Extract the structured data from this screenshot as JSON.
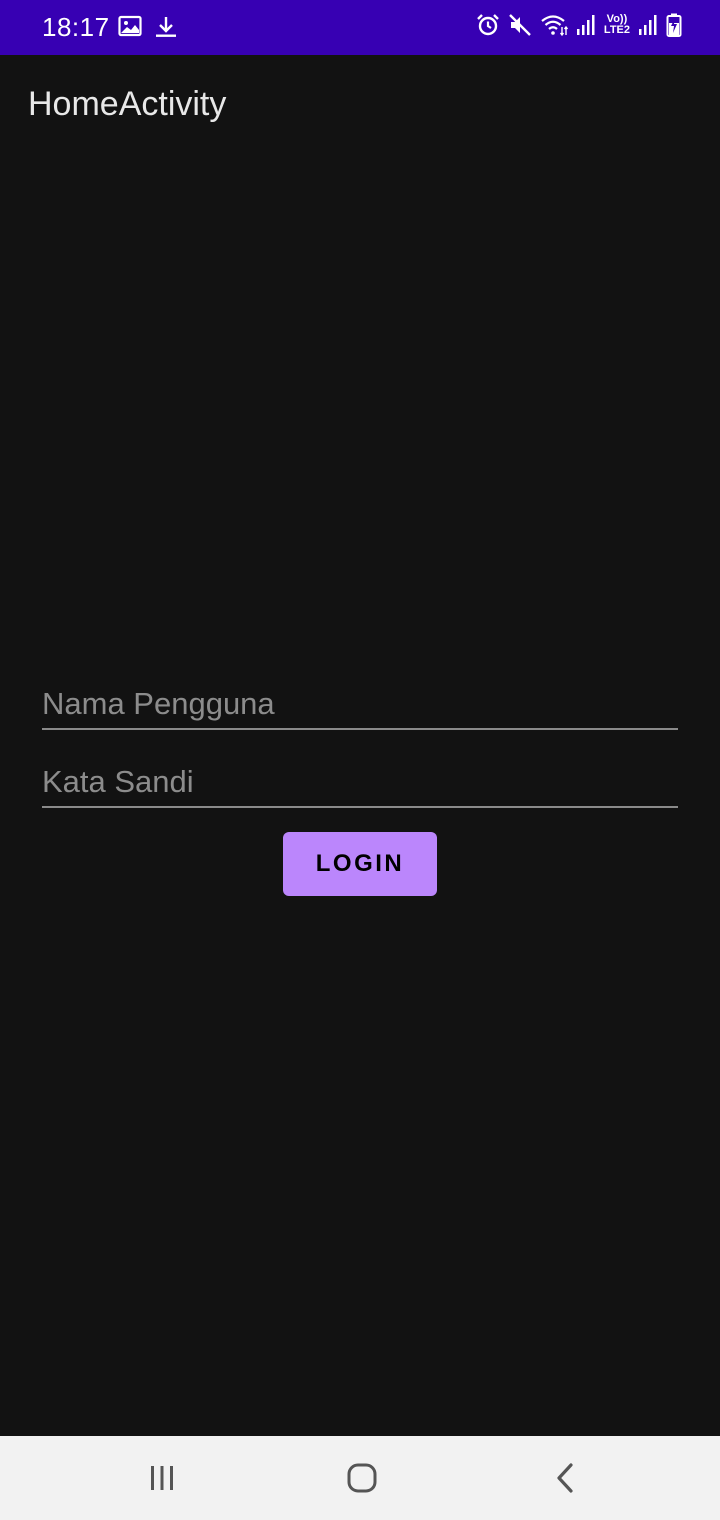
{
  "status_bar": {
    "time": "18:17",
    "volte_line1": "Vo))",
    "volte_line2": "LTE2",
    "background": "#3700b3",
    "left_icons": [
      "image-icon",
      "download-icon"
    ],
    "right_icons": [
      "alarm-icon",
      "mute-icon",
      "wifi-icon",
      "signal-icon",
      "volte-icon",
      "signal-icon",
      "battery-charging-icon"
    ]
  },
  "app_bar": {
    "title": "HomeActivity"
  },
  "form": {
    "username_placeholder": "Nama Pengguna",
    "password_placeholder": "Kata Sandi",
    "login_label": "LOGIN",
    "accent_color": "#bb86fc"
  },
  "nav_bar": {
    "buttons": [
      "recents-icon",
      "home-icon",
      "back-icon"
    ]
  },
  "theme": {
    "background": "#121212"
  }
}
